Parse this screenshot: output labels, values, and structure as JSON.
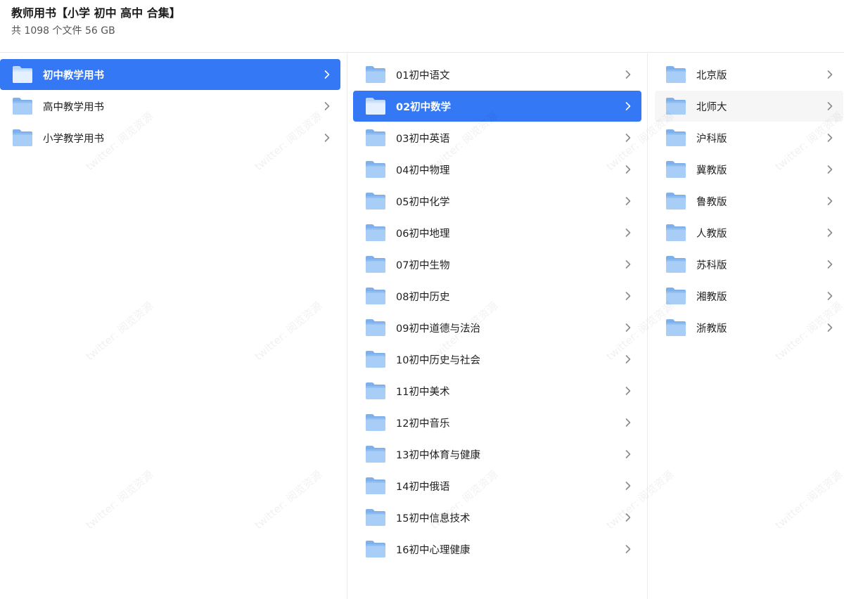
{
  "header": {
    "title": "教师用书【小学 初中 高中 合集】",
    "subtitle": "共 1098 个文件 56 GB"
  },
  "column1": {
    "items": [
      {
        "label": "初中教学用书",
        "selected": true
      },
      {
        "label": "高中教学用书",
        "selected": false
      },
      {
        "label": "小学教学用书",
        "selected": false
      }
    ]
  },
  "column2": {
    "items": [
      {
        "label": "01初中语文",
        "selected": false
      },
      {
        "label": "02初中数学",
        "selected": true
      },
      {
        "label": "03初中英语",
        "selected": false
      },
      {
        "label": "04初中物理",
        "selected": false
      },
      {
        "label": "05初中化学",
        "selected": false
      },
      {
        "label": "06初中地理",
        "selected": false
      },
      {
        "label": "07初中生物",
        "selected": false
      },
      {
        "label": "08初中历史",
        "selected": false
      },
      {
        "label": "09初中道德与法治",
        "selected": false
      },
      {
        "label": "10初中历史与社会",
        "selected": false
      },
      {
        "label": "11初中美术",
        "selected": false
      },
      {
        "label": "12初中音乐",
        "selected": false
      },
      {
        "label": "13初中体育与健康",
        "selected": false
      },
      {
        "label": "14初中俄语",
        "selected": false
      },
      {
        "label": "15初中信息技术",
        "selected": false
      },
      {
        "label": "16初中心理健康",
        "selected": false
      }
    ]
  },
  "column3": {
    "items": [
      {
        "label": "北京版",
        "hovered": false
      },
      {
        "label": "北师大",
        "hovered": true
      },
      {
        "label": "沪科版",
        "hovered": false
      },
      {
        "label": "冀教版",
        "hovered": false
      },
      {
        "label": "鲁教版",
        "hovered": false
      },
      {
        "label": "人教版",
        "hovered": false
      },
      {
        "label": "苏科版",
        "hovered": false
      },
      {
        "label": "湘教版",
        "hovered": false
      },
      {
        "label": "浙教版",
        "hovered": false
      }
    ]
  },
  "watermark": {
    "text": "twitter: 阅览资源"
  },
  "colors": {
    "selected_bg": "#3478f6",
    "hover_bg": "#f6f6f7",
    "folder_light": "#a9cdf5",
    "folder_dark": "#7fb3ee"
  },
  "icons": {
    "folder": "folder-icon",
    "chevron": "chevron-right-icon"
  }
}
